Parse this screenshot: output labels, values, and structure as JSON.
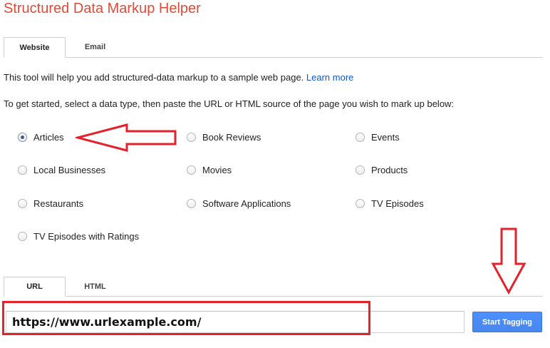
{
  "app": {
    "title": "Structured Data Markup Helper"
  },
  "top_tabs": [
    {
      "label": "Website",
      "active": true
    },
    {
      "label": "Email",
      "active": false
    }
  ],
  "intro": {
    "text": "This tool will help you add structured-data markup to a sample web page. ",
    "link_label": "Learn more"
  },
  "instruction": "To get started, select a data type, then paste the URL or HTML source of the page you wish to mark up below:",
  "data_types": [
    {
      "label": "Articles",
      "checked": true
    },
    {
      "label": "Book Reviews",
      "checked": false
    },
    {
      "label": "Events",
      "checked": false
    },
    {
      "label": "Local Businesses",
      "checked": false
    },
    {
      "label": "Movies",
      "checked": false
    },
    {
      "label": "Products",
      "checked": false
    },
    {
      "label": "Restaurants",
      "checked": false
    },
    {
      "label": "Software Applications",
      "checked": false
    },
    {
      "label": "TV Episodes",
      "checked": false
    },
    {
      "label": "TV Episodes with Ratings",
      "checked": false
    }
  ],
  "source_tabs": [
    {
      "label": "URL",
      "active": true
    },
    {
      "label": "HTML",
      "active": false
    }
  ],
  "url_input": {
    "value": "https://www.urlexample.com/"
  },
  "start_button": {
    "label": "Start Tagging"
  },
  "colors": {
    "title": "#dd4b39",
    "link": "#1155cc",
    "button": "#4d90fe",
    "annotation": "#e3222b"
  },
  "icons": {
    "radio": "radio-button-icon",
    "annotation_left": "arrow-left-icon",
    "annotation_down": "arrow-down-icon"
  }
}
